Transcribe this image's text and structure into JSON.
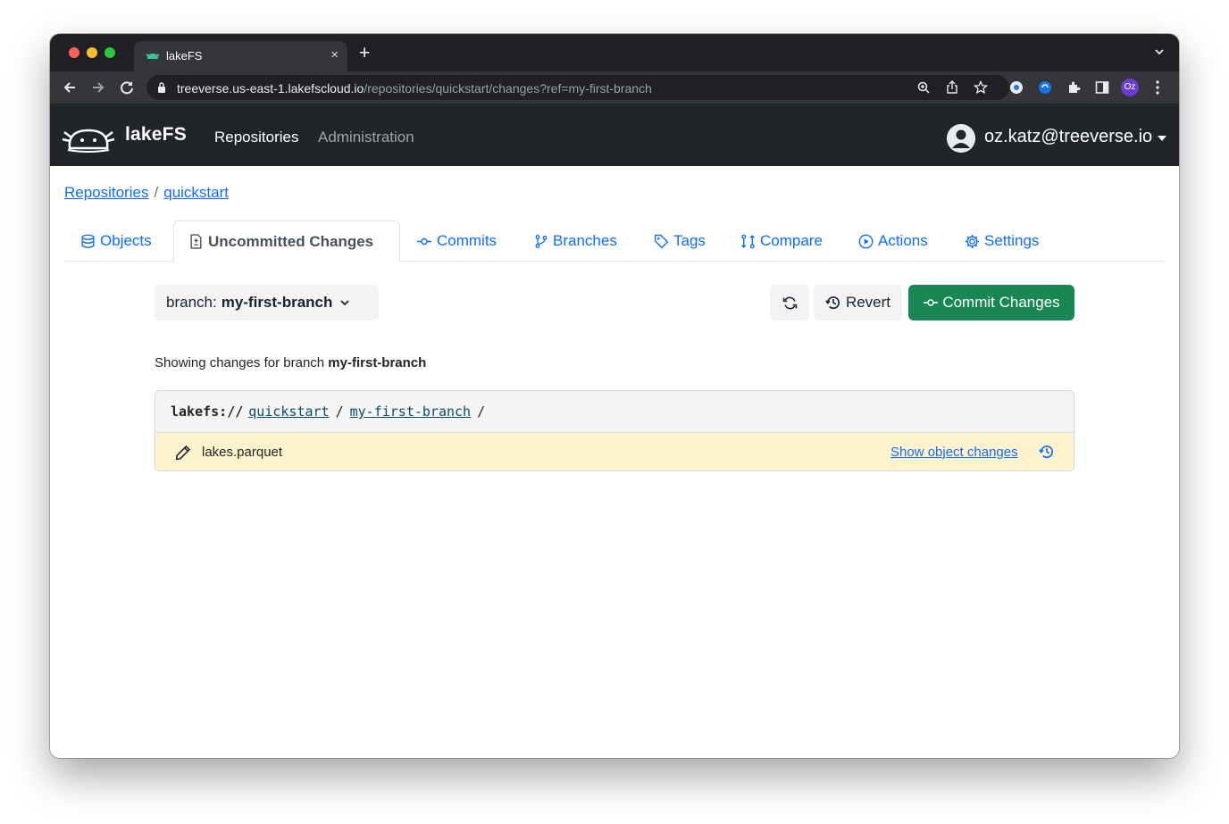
{
  "browser": {
    "tab_title": "lakeFS",
    "tab_close": "×",
    "new_tab": "+",
    "url_host": "treeverse.us-east-1.lakefscloud.io",
    "url_path": "/repositories/quickstart/changes?ref=my-first-branch",
    "profile_initials": "Oz"
  },
  "navbar": {
    "brand": "lakeFS",
    "links": [
      "Repositories",
      "Administration"
    ],
    "user_email": "oz.katz@treeverse.io"
  },
  "breadcrumb": {
    "items": [
      "Repositories",
      "quickstart"
    ],
    "separator": "/"
  },
  "repo_tabs": [
    {
      "label": "Objects",
      "icon": "database-icon"
    },
    {
      "label": "Uncommitted Changes",
      "icon": "file-diff-icon",
      "active": true
    },
    {
      "label": "Commits",
      "icon": "git-commit-icon"
    },
    {
      "label": "Branches",
      "icon": "git-branch-icon"
    },
    {
      "label": "Tags",
      "icon": "tag-icon"
    },
    {
      "label": "Compare",
      "icon": "compare-icon"
    },
    {
      "label": "Actions",
      "icon": "play-icon"
    },
    {
      "label": "Settings",
      "icon": "gear-icon"
    }
  ],
  "toolbar": {
    "branch_prefix": "branch:",
    "branch_name": "my-first-branch",
    "revert_label": "Revert",
    "commit_label": "Commit Changes"
  },
  "changes": {
    "showing_prefix": "Showing changes for branch",
    "branch_name": "my-first-branch",
    "path_protocol": "lakefs://",
    "path_repo": "quickstart",
    "path_branch": "my-first-branch",
    "path_sep": "/",
    "entries": [
      {
        "name": "lakes.parquet",
        "change_type": "modified",
        "action_label": "Show object changes"
      }
    ]
  },
  "colors": {
    "navbar_bg": "#212529",
    "link": "#0d6efd",
    "commit_button": "#198754",
    "modified_row": "#fff3cd"
  }
}
